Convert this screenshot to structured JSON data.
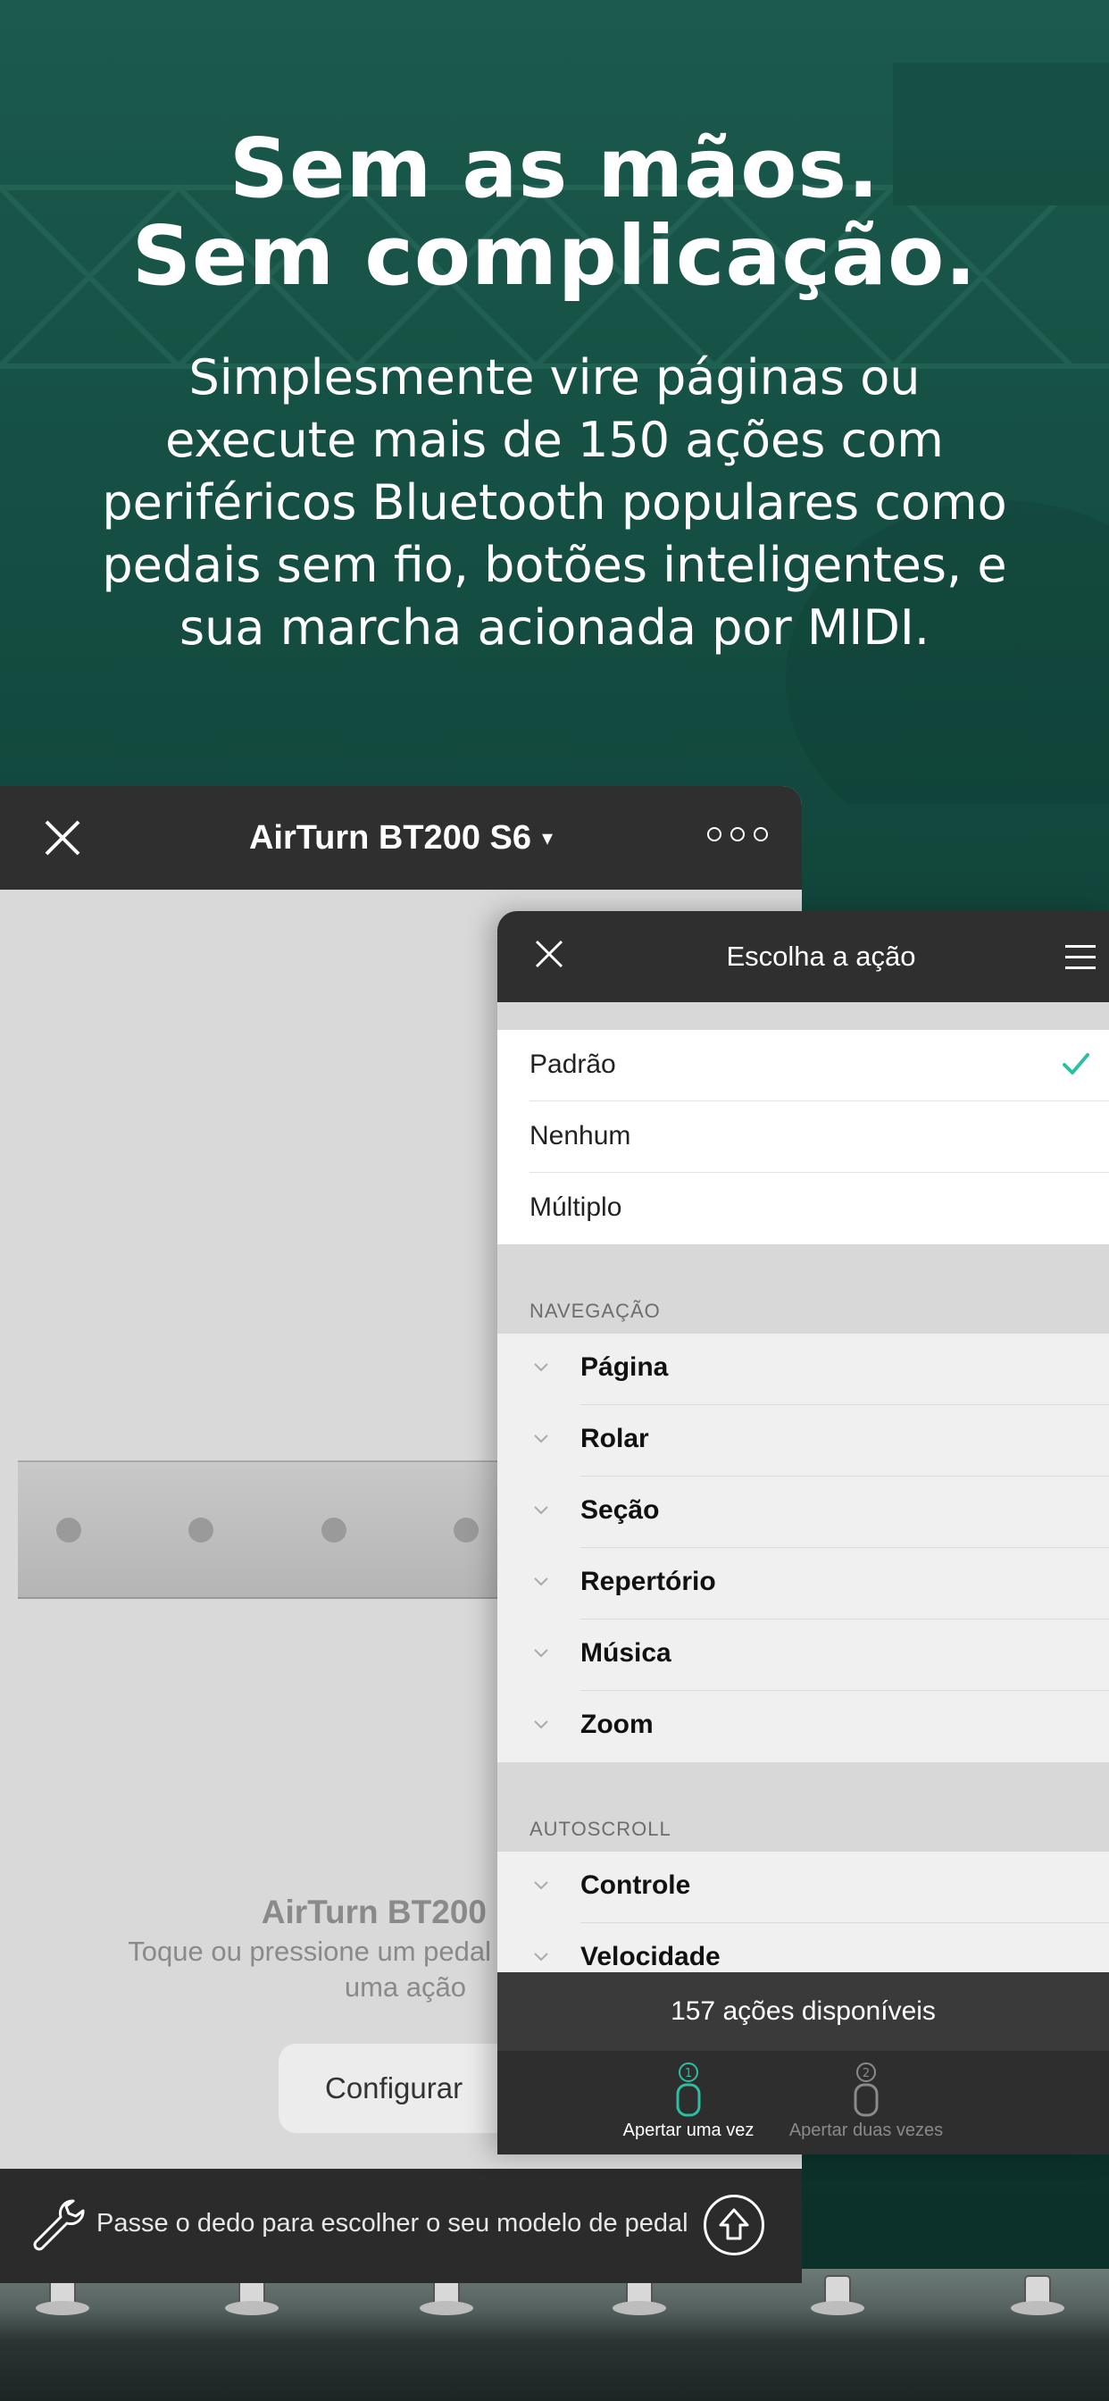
{
  "hero": {
    "headline_line1": "Sem as mãos.",
    "headline_line2": "Sem complicação.",
    "subhead_line1": "Simplesmente vire páginas ou",
    "subhead_line2": "execute mais de 150 ações com",
    "subhead_line3": "periféricos Bluetooth populares como",
    "subhead_line4": "pedais sem fio, botões inteligentes, e",
    "subhead_line5": "sua marcha acionada por MIDI."
  },
  "main_panel": {
    "title": "AirTurn BT200 S6",
    "title_caret": "▾",
    "device_name": "AirTurn BT200",
    "device_hint_line1": "Toque ou pressione um pedal",
    "device_hint_line2": "uma ação",
    "configure_label": "Configurar",
    "pedal_count": 4
  },
  "swipe_bar": {
    "text": "Passe o dedo para escolher o seu modelo de pedal"
  },
  "action_panel": {
    "title": "Escolha a ação",
    "options": [
      {
        "label": "Padrão",
        "selected": true
      },
      {
        "label": "Nenhum",
        "selected": false
      },
      {
        "label": "Múltiplo",
        "selected": false
      }
    ],
    "sections": [
      {
        "header": "NAVEGAÇÃO",
        "items": [
          "Página",
          "Rolar",
          "Seção",
          "Repertório",
          "Música",
          "Zoom"
        ]
      },
      {
        "header": "AUTOSCROLL",
        "items": [
          "Controle",
          "Velocidade"
        ]
      }
    ],
    "available_count": "157 ações disponíveis",
    "press_single_label": "Apertar uma vez",
    "press_single_number": "1",
    "press_double_label": "Apertar duas vezes",
    "press_double_number": "2"
  },
  "colors": {
    "accent": "#2bbfa4",
    "hero_bg": "#134a3f",
    "dark_bar": "#2f2f2f"
  }
}
